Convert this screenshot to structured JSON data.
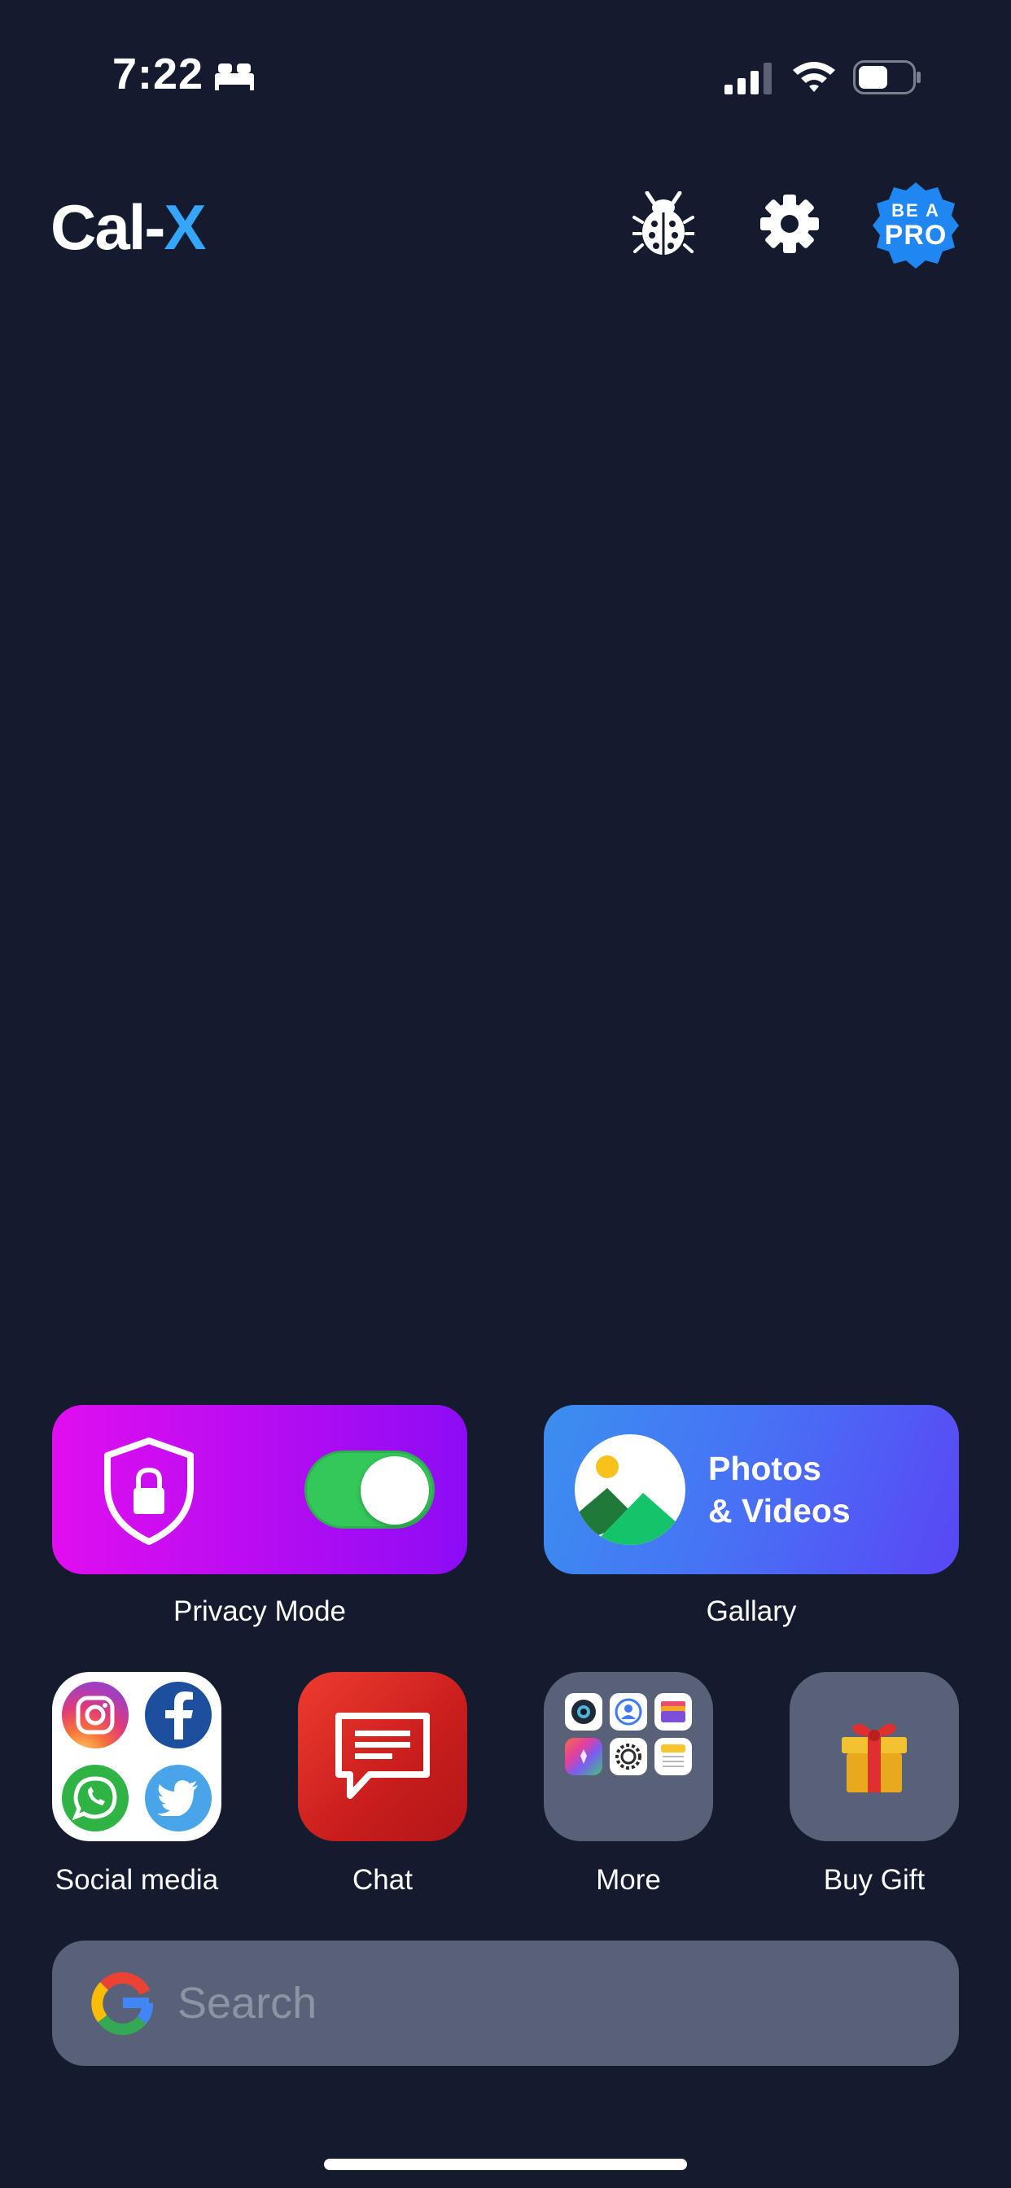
{
  "status_bar": {
    "time": "7:22",
    "battery_level": 0.55
  },
  "header": {
    "logo_main": "Cal-",
    "logo_accent": "X",
    "pro_badge": {
      "line1": "BE A",
      "line2": "PRO"
    }
  },
  "widgets": {
    "privacy": {
      "label": "Privacy Mode",
      "enabled": true
    },
    "gallery": {
      "title_line1": "Photos",
      "title_line2": "& Videos",
      "label": "Gallary"
    }
  },
  "apps": [
    {
      "label": "Social media"
    },
    {
      "label": "Chat"
    },
    {
      "label": "More"
    },
    {
      "label": "Buy Gift"
    }
  ],
  "search": {
    "placeholder": "Search"
  },
  "colors": {
    "background": "#141b2e",
    "accent_blue": "#35a6ff",
    "privacy_magenta": "#e00ef0",
    "toggle_green": "#34c759",
    "gallery_blue": "#3b8ff0",
    "tile_gray": "#586178"
  },
  "icons": [
    "sleep-icon",
    "signal-icon",
    "wifi-icon",
    "battery-icon",
    "bug-icon",
    "gear-icon",
    "shield-lock-icon",
    "gallery-photo-icon",
    "instagram-icon",
    "facebook-icon",
    "whatsapp-icon",
    "twitter-icon",
    "chat-icon",
    "gift-icon",
    "google-icon"
  ]
}
